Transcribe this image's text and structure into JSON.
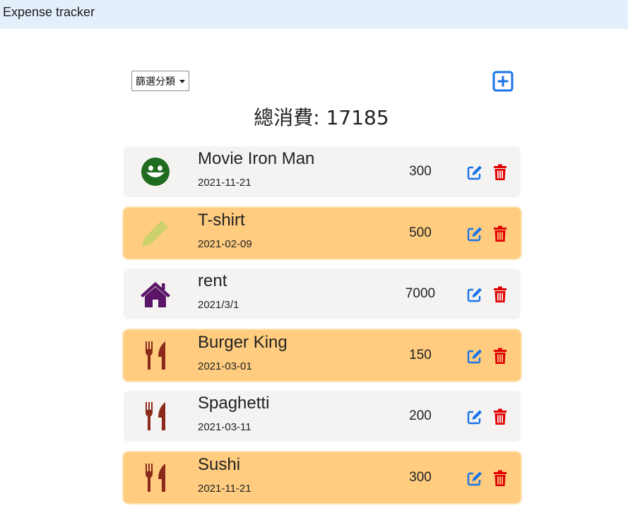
{
  "app": {
    "title": "Expense tracker"
  },
  "toolbar": {
    "filter_label": "篩選分類"
  },
  "summary": {
    "total_label": "總消費: 17185"
  },
  "colors": {
    "navbar_bg": "#e3f0fc",
    "item_grey": "#f5f3f2",
    "item_orange": "#ffcc80",
    "edit_blue": "#1a73e8",
    "delete_red": "#e00000"
  },
  "records": [
    {
      "name": "Movie Iron Man",
      "date": "2021-11-21",
      "amount": "300",
      "category_icon": "grin-icon",
      "icon_color": "#1f6b1f"
    },
    {
      "name": "T-shirt",
      "date": "2021-02-09",
      "amount": "500",
      "category_icon": "pencil-icon",
      "icon_color": "#cdd16a"
    },
    {
      "name": "rent",
      "date": "2021/3/1",
      "amount": "7000",
      "category_icon": "home-icon",
      "icon_color": "#5a1566"
    },
    {
      "name": "Burger King",
      "date": "2021-03-01",
      "amount": "150",
      "category_icon": "utensils-icon",
      "icon_color": "#8b2a1a"
    },
    {
      "name": "Spaghetti",
      "date": "2021-03-11",
      "amount": "200",
      "category_icon": "utensils-icon",
      "icon_color": "#8b2a1a"
    },
    {
      "name": "Sushi",
      "date": "2021-11-21",
      "amount": "300",
      "category_icon": "utensils-icon",
      "icon_color": "#8b2a1a"
    }
  ]
}
